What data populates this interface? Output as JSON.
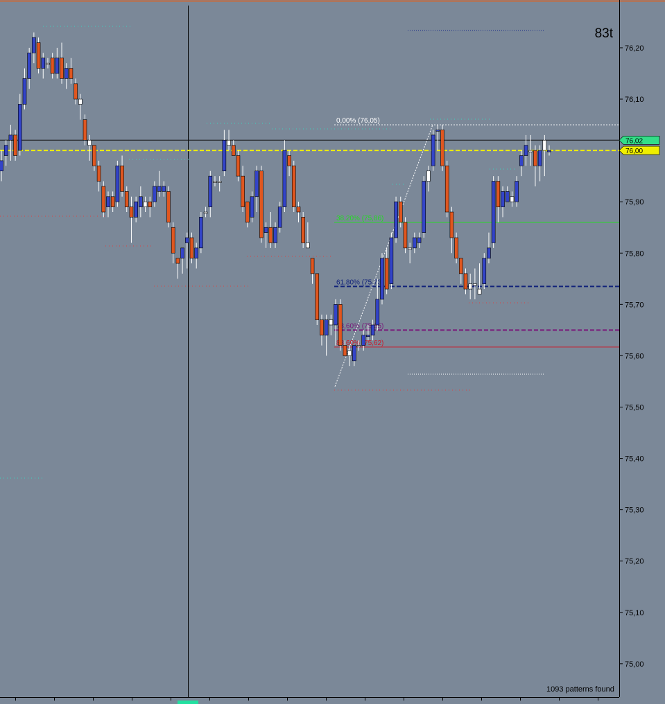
{
  "chart_data": {
    "type": "candlestick",
    "timeframe_label": "83t",
    "patterns_found_label": "1093 patterns found",
    "ylim": [
      74.935,
      76.285
    ],
    "y_ticks": [
      "76,20",
      "76,10",
      "76,00",
      "75,90",
      "75,80",
      "75,70",
      "75,60",
      "75,50",
      "75,40",
      "75,30",
      "75,20",
      "75,10",
      "75,00"
    ],
    "y_tick_values": [
      76.2,
      76.1,
      76.0,
      75.9,
      75.8,
      75.7,
      75.6,
      75.5,
      75.4,
      75.3,
      75.2,
      75.1,
      75.0
    ],
    "price_tags": [
      {
        "label": "76,02",
        "value": 76.02,
        "color": "#33dd88"
      },
      {
        "label": "76,00",
        "value": 76.0,
        "color": "#f0ef00"
      }
    ],
    "current_price": 76.02,
    "reference_level": 76.0,
    "fibonacci": {
      "high": 76.05,
      "low": 75.54,
      "levels": [
        {
          "label": "0,00% (76,05)",
          "value": 76.05,
          "color": "#ffffff",
          "style": "dotted"
        },
        {
          "label": "38,20% (75,86)",
          "value": 75.86,
          "color": "#22dd22",
          "style": "solid"
        },
        {
          "label": "61,80% (75,73)",
          "value": 75.735,
          "color": "#11227a",
          "style": "dashed"
        },
        {
          "label": "78,60% (75,65)",
          "value": 75.65,
          "color": "#7a1a7a",
          "style": "dashed"
        },
        {
          "label": "88,60% (75,62)",
          "value": 75.617,
          "color": "#cc1a2a",
          "style": "solid"
        }
      ]
    },
    "candles": [
      {
        "o": 75.96,
        "h": 76.0,
        "l": 75.94,
        "c": 75.98,
        "dir": "up"
      },
      {
        "o": 75.99,
        "h": 76.02,
        "l": 75.97,
        "c": 76.01,
        "dir": "up"
      },
      {
        "o": 76.02,
        "h": 76.05,
        "l": 75.98,
        "c": 76.03,
        "dir": "up"
      },
      {
        "o": 76.03,
        "h": 76.04,
        "l": 75.98,
        "c": 75.99,
        "dir": "down"
      },
      {
        "o": 76.0,
        "h": 76.11,
        "l": 75.99,
        "c": 76.09,
        "dir": "up"
      },
      {
        "o": 76.09,
        "h": 76.16,
        "l": 76.08,
        "c": 76.14,
        "dir": "up"
      },
      {
        "o": 76.14,
        "h": 76.2,
        "l": 76.12,
        "c": 76.19,
        "dir": "up"
      },
      {
        "o": 76.19,
        "h": 76.23,
        "l": 76.17,
        "c": 76.22,
        "dir": "up"
      },
      {
        "o": 76.21,
        "h": 76.22,
        "l": 76.15,
        "c": 76.16,
        "dir": "down"
      },
      {
        "o": 76.16,
        "h": 76.19,
        "l": 76.14,
        "c": 76.18,
        "dir": "up"
      },
      {
        "o": 76.17,
        "h": 76.18,
        "l": 76.16,
        "c": 76.17,
        "dir": "doji"
      },
      {
        "o": 76.18,
        "h": 76.19,
        "l": 76.14,
        "c": 76.15,
        "dir": "down"
      },
      {
        "o": 76.15,
        "h": 76.2,
        "l": 76.14,
        "c": 76.18,
        "dir": "up"
      },
      {
        "o": 76.18,
        "h": 76.21,
        "l": 76.13,
        "c": 76.14,
        "dir": "down"
      },
      {
        "o": 76.14,
        "h": 76.17,
        "l": 76.12,
        "c": 76.16,
        "dir": "up"
      },
      {
        "o": 76.16,
        "h": 76.18,
        "l": 76.13,
        "c": 76.14,
        "dir": "down"
      },
      {
        "o": 76.13,
        "h": 76.14,
        "l": 76.09,
        "c": 76.1,
        "dir": "down"
      },
      {
        "o": 76.1,
        "h": 76.11,
        "l": 76.06,
        "c": 76.09,
        "dir": "doji"
      },
      {
        "o": 76.06,
        "h": 76.07,
        "l": 76.01,
        "c": 76.02,
        "dir": "down"
      },
      {
        "o": 76.02,
        "h": 76.03,
        "l": 75.98,
        "c": 76.01,
        "dir": "doji"
      },
      {
        "o": 76.01,
        "h": 76.01,
        "l": 75.96,
        "c": 75.97,
        "dir": "down"
      },
      {
        "o": 75.97,
        "h": 75.98,
        "l": 75.92,
        "c": 75.94,
        "dir": "down"
      },
      {
        "o": 75.93,
        "h": 75.94,
        "l": 75.87,
        "c": 75.88,
        "dir": "down"
      },
      {
        "o": 75.89,
        "h": 75.92,
        "l": 75.87,
        "c": 75.91,
        "dir": "up"
      },
      {
        "o": 75.91,
        "h": 75.92,
        "l": 75.88,
        "c": 75.89,
        "dir": "down"
      },
      {
        "o": 75.9,
        "h": 75.98,
        "l": 75.89,
        "c": 75.97,
        "dir": "up"
      },
      {
        "o": 75.97,
        "h": 75.99,
        "l": 75.91,
        "c": 75.92,
        "dir": "down"
      },
      {
        "o": 75.92,
        "h": 75.93,
        "l": 75.88,
        "c": 75.89,
        "dir": "down"
      },
      {
        "o": 75.89,
        "h": 75.91,
        "l": 75.82,
        "c": 75.87,
        "dir": "down"
      },
      {
        "o": 75.87,
        "h": 75.91,
        "l": 75.86,
        "c": 75.9,
        "dir": "up"
      },
      {
        "o": 75.89,
        "h": 75.93,
        "l": 75.87,
        "c": 75.91,
        "dir": "up"
      },
      {
        "o": 75.9,
        "h": 75.91,
        "l": 75.88,
        "c": 75.89,
        "dir": "doji"
      },
      {
        "o": 75.89,
        "h": 75.91,
        "l": 75.87,
        "c": 75.9,
        "dir": "down"
      },
      {
        "o": 75.9,
        "h": 75.94,
        "l": 75.89,
        "c": 75.93,
        "dir": "up"
      },
      {
        "o": 75.93,
        "h": 75.96,
        "l": 75.91,
        "c": 75.92,
        "dir": "up"
      },
      {
        "o": 75.93,
        "h": 75.94,
        "l": 75.91,
        "c": 75.92,
        "dir": "up"
      },
      {
        "o": 75.92,
        "h": 75.93,
        "l": 75.85,
        "c": 75.86,
        "dir": "down"
      },
      {
        "o": 75.85,
        "h": 75.86,
        "l": 75.78,
        "c": 75.8,
        "dir": "down"
      },
      {
        "o": 75.79,
        "h": 75.79,
        "l": 75.75,
        "c": 75.78,
        "dir": "down"
      },
      {
        "o": 75.79,
        "h": 75.81,
        "l": 75.76,
        "c": 75.81,
        "dir": "up"
      },
      {
        "o": 75.82,
        "h": 75.84,
        "l": 75.77,
        "c": 75.83,
        "dir": "up"
      },
      {
        "o": 75.83,
        "h": 75.84,
        "l": 75.78,
        "c": 75.79,
        "dir": "down"
      },
      {
        "o": 75.79,
        "h": 75.82,
        "l": 75.77,
        "c": 75.81,
        "dir": "up"
      },
      {
        "o": 75.81,
        "h": 75.88,
        "l": 75.8,
        "c": 75.87,
        "dir": "up"
      },
      {
        "o": 75.88,
        "h": 75.89,
        "l": 75.87,
        "c": 75.88,
        "dir": "doji"
      },
      {
        "o": 75.89,
        "h": 75.96,
        "l": 75.87,
        "c": 75.95,
        "dir": "up"
      },
      {
        "o": 75.94,
        "h": 75.95,
        "l": 75.93,
        "c": 75.94,
        "dir": "doji"
      },
      {
        "o": 75.94,
        "h": 75.95,
        "l": 75.92,
        "c": 75.94,
        "dir": "doji"
      },
      {
        "o": 75.96,
        "h": 76.04,
        "l": 75.95,
        "c": 76.02,
        "dir": "up"
      },
      {
        "o": 76.02,
        "h": 76.04,
        "l": 76.0,
        "c": 76.01,
        "dir": "doji"
      },
      {
        "o": 76.01,
        "h": 76.02,
        "l": 75.99,
        "c": 75.99,
        "dir": "down"
      },
      {
        "o": 75.99,
        "h": 76.0,
        "l": 75.94,
        "c": 75.95,
        "dir": "down"
      },
      {
        "o": 75.95,
        "h": 75.97,
        "l": 75.88,
        "c": 75.89,
        "dir": "down"
      },
      {
        "o": 75.9,
        "h": 75.9,
        "l": 75.85,
        "c": 75.86,
        "dir": "down"
      },
      {
        "o": 75.87,
        "h": 75.92,
        "l": 75.86,
        "c": 75.91,
        "dir": "up"
      },
      {
        "o": 75.91,
        "h": 75.97,
        "l": 75.88,
        "c": 75.96,
        "dir": "up"
      },
      {
        "o": 75.96,
        "h": 75.97,
        "l": 75.82,
        "c": 75.83,
        "dir": "down"
      },
      {
        "o": 75.84,
        "h": 75.86,
        "l": 75.81,
        "c": 75.85,
        "dir": "up"
      },
      {
        "o": 75.85,
        "h": 75.88,
        "l": 75.81,
        "c": 75.82,
        "dir": "down"
      },
      {
        "o": 75.82,
        "h": 75.86,
        "l": 75.81,
        "c": 75.85,
        "dir": "up"
      },
      {
        "o": 75.85,
        "h": 75.9,
        "l": 75.84,
        "c": 75.89,
        "dir": "up"
      },
      {
        "o": 75.89,
        "h": 76.02,
        "l": 75.88,
        "c": 76.0,
        "dir": "up"
      },
      {
        "o": 75.99,
        "h": 76.0,
        "l": 75.95,
        "c": 75.97,
        "dir": "down"
      },
      {
        "o": 75.97,
        "h": 75.98,
        "l": 75.88,
        "c": 75.89,
        "dir": "down"
      },
      {
        "o": 75.89,
        "h": 75.9,
        "l": 75.86,
        "c": 75.88,
        "dir": "down"
      },
      {
        "o": 75.87,
        "h": 75.88,
        "l": 75.81,
        "c": 75.82,
        "dir": "down"
      },
      {
        "o": 75.82,
        "h": 75.86,
        "l": 75.81,
        "c": 75.81,
        "dir": "doji"
      },
      {
        "o": 75.79,
        "h": 75.79,
        "l": 75.74,
        "c": 75.76,
        "dir": "down"
      },
      {
        "o": 75.76,
        "h": 75.76,
        "l": 75.66,
        "c": 75.67,
        "dir": "down"
      },
      {
        "o": 75.67,
        "h": 75.68,
        "l": 75.62,
        "c": 75.64,
        "dir": "down"
      },
      {
        "o": 75.64,
        "h": 75.68,
        "l": 75.6,
        "c": 75.67,
        "dir": "up"
      },
      {
        "o": 75.67,
        "h": 75.68,
        "l": 75.64,
        "c": 75.66,
        "dir": "doji"
      },
      {
        "o": 75.66,
        "h": 75.71,
        "l": 75.62,
        "c": 75.7,
        "dir": "up"
      },
      {
        "o": 75.7,
        "h": 75.71,
        "l": 75.61,
        "c": 75.62,
        "dir": "down"
      },
      {
        "o": 75.62,
        "h": 75.63,
        "l": 75.6,
        "c": 75.6,
        "dir": "down"
      },
      {
        "o": 75.6,
        "h": 75.62,
        "l": 75.58,
        "c": 75.61,
        "dir": "doji"
      },
      {
        "o": 75.59,
        "h": 75.62,
        "l": 75.58,
        "c": 75.62,
        "dir": "up"
      },
      {
        "o": 75.62,
        "h": 75.63,
        "l": 75.61,
        "c": 75.62,
        "dir": "doji"
      },
      {
        "o": 75.62,
        "h": 75.65,
        "l": 75.61,
        "c": 75.64,
        "dir": "up"
      },
      {
        "o": 75.64,
        "h": 75.66,
        "l": 75.63,
        "c": 75.64,
        "dir": "up"
      },
      {
        "o": 75.64,
        "h": 75.67,
        "l": 75.63,
        "c": 75.66,
        "dir": "up"
      },
      {
        "o": 75.66,
        "h": 75.75,
        "l": 75.65,
        "c": 75.71,
        "dir": "up"
      },
      {
        "o": 75.71,
        "h": 75.8,
        "l": 75.7,
        "c": 75.79,
        "dir": "up"
      },
      {
        "o": 75.79,
        "h": 75.81,
        "l": 75.72,
        "c": 75.73,
        "dir": "down"
      },
      {
        "o": 75.74,
        "h": 75.84,
        "l": 75.73,
        "c": 75.83,
        "dir": "up"
      },
      {
        "o": 75.83,
        "h": 75.91,
        "l": 75.82,
        "c": 75.9,
        "dir": "up"
      },
      {
        "o": 75.9,
        "h": 75.91,
        "l": 75.85,
        "c": 75.86,
        "dir": "down"
      },
      {
        "o": 75.86,
        "h": 75.87,
        "l": 75.8,
        "c": 75.81,
        "dir": "down"
      },
      {
        "o": 75.81,
        "h": 75.82,
        "l": 75.78,
        "c": 75.81,
        "dir": "doji"
      },
      {
        "o": 75.81,
        "h": 75.84,
        "l": 75.8,
        "c": 75.83,
        "dir": "up"
      },
      {
        "o": 75.82,
        "h": 75.84,
        "l": 75.81,
        "c": 75.83,
        "dir": "up"
      },
      {
        "o": 75.84,
        "h": 75.95,
        "l": 75.83,
        "c": 75.94,
        "dir": "up"
      },
      {
        "o": 75.94,
        "h": 75.97,
        "l": 75.92,
        "c": 75.96,
        "dir": "doji"
      },
      {
        "o": 75.97,
        "h": 76.04,
        "l": 75.96,
        "c": 76.03,
        "dir": "up"
      },
      {
        "o": 76.04,
        "h": 76.05,
        "l": 76.0,
        "c": 76.04,
        "dir": "up"
      },
      {
        "o": 76.04,
        "h": 76.05,
        "l": 75.96,
        "c": 75.97,
        "dir": "down"
      },
      {
        "o": 75.97,
        "h": 75.98,
        "l": 75.87,
        "c": 75.88,
        "dir": "down"
      },
      {
        "o": 75.88,
        "h": 75.89,
        "l": 75.8,
        "c": 75.83,
        "dir": "down"
      },
      {
        "o": 75.83,
        "h": 75.84,
        "l": 75.78,
        "c": 75.79,
        "dir": "down"
      },
      {
        "o": 75.79,
        "h": 75.79,
        "l": 75.74,
        "c": 75.76,
        "dir": "down"
      },
      {
        "o": 75.76,
        "h": 75.77,
        "l": 75.72,
        "c": 75.73,
        "dir": "down"
      },
      {
        "o": 75.73,
        "h": 75.76,
        "l": 75.71,
        "c": 75.74,
        "dir": "doji"
      },
      {
        "o": 75.74,
        "h": 75.77,
        "l": 75.71,
        "c": 75.74,
        "dir": "doji"
      },
      {
        "o": 75.73,
        "h": 75.78,
        "l": 75.72,
        "c": 75.72,
        "dir": "doji"
      },
      {
        "o": 75.74,
        "h": 75.8,
        "l": 75.73,
        "c": 75.79,
        "dir": "up"
      },
      {
        "o": 75.79,
        "h": 75.84,
        "l": 75.78,
        "c": 75.81,
        "dir": "up"
      },
      {
        "o": 75.82,
        "h": 75.95,
        "l": 75.81,
        "c": 75.94,
        "dir": "up"
      },
      {
        "o": 75.94,
        "h": 75.95,
        "l": 75.86,
        "c": 75.89,
        "dir": "down"
      },
      {
        "o": 75.89,
        "h": 75.93,
        "l": 75.87,
        "c": 75.92,
        "dir": "up"
      },
      {
        "o": 75.92,
        "h": 75.93,
        "l": 75.9,
        "c": 75.9,
        "dir": "up"
      },
      {
        "o": 75.9,
        "h": 75.92,
        "l": 75.89,
        "c": 75.91,
        "dir": "doji"
      },
      {
        "o": 75.9,
        "h": 75.95,
        "l": 75.89,
        "c": 75.94,
        "dir": "up"
      },
      {
        "o": 75.97,
        "h": 76.0,
        "l": 75.95,
        "c": 75.99,
        "dir": "up"
      },
      {
        "o": 75.99,
        "h": 76.03,
        "l": 75.97,
        "c": 76.01,
        "dir": "up"
      },
      {
        "o": 76.0,
        "h": 76.03,
        "l": 75.97,
        "c": 76.0,
        "dir": "doji"
      },
      {
        "o": 76.0,
        "h": 76.01,
        "l": 75.93,
        "c": 75.97,
        "dir": "down"
      },
      {
        "o": 75.97,
        "h": 76.01,
        "l": 75.94,
        "c": 76.0,
        "dir": "up"
      },
      {
        "o": 76.02,
        "h": 76.03,
        "l": 75.95,
        "c": 76.0,
        "dir": "doji"
      },
      {
        "o": 76.0,
        "h": 76.01,
        "l": 75.99,
        "c": 76.0,
        "dir": "up"
      }
    ],
    "colors": {
      "background": "#7b8898",
      "axis_panel": "#7b8898",
      "up_body": "#3344c8",
      "down_body": "#e0561f",
      "doji_body": "#ffffff",
      "wick": "#ffffff",
      "current_line": "#111111",
      "reference_line": "#f0ef00"
    }
  }
}
